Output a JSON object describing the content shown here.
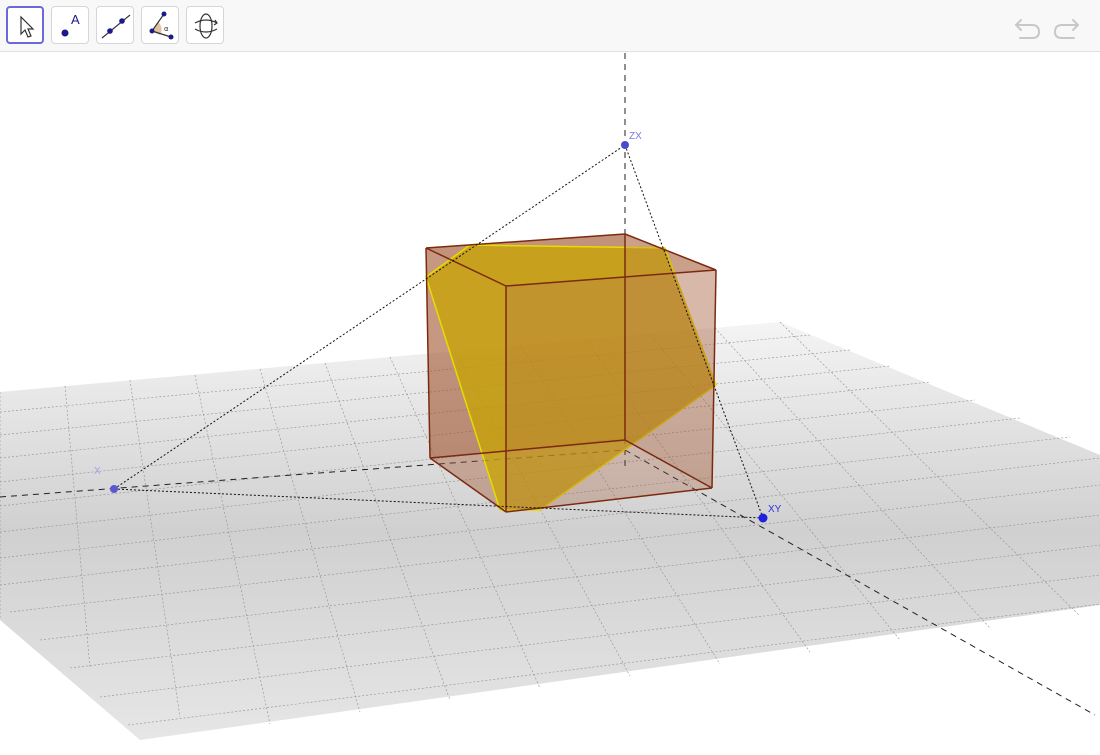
{
  "toolbar": {
    "tools": [
      {
        "icon": "move-arrow-icon",
        "selected": true
      },
      {
        "icon": "point-icon",
        "selected": false
      },
      {
        "icon": "line-icon",
        "selected": false
      },
      {
        "icon": "angle-icon",
        "selected": false
      },
      {
        "icon": "rotate-view-icon",
        "selected": false
      }
    ],
    "point_tool_letter": "A",
    "angle_tool_symbol": "α",
    "undo_icon": "undo-icon",
    "redo_icon": "redo-icon"
  },
  "view3d": {
    "points": {
      "x_label": "X",
      "xy_label": "XY",
      "zx_label": "ZX"
    },
    "colors": {
      "cube_edge": "#7b2a10",
      "cube_fill": "#a0522d",
      "section_fill": "#c8a400",
      "section_edge": "#e0d000",
      "point_color": "#3b3bd9",
      "grid_plane": "#d4d4d4"
    }
  }
}
